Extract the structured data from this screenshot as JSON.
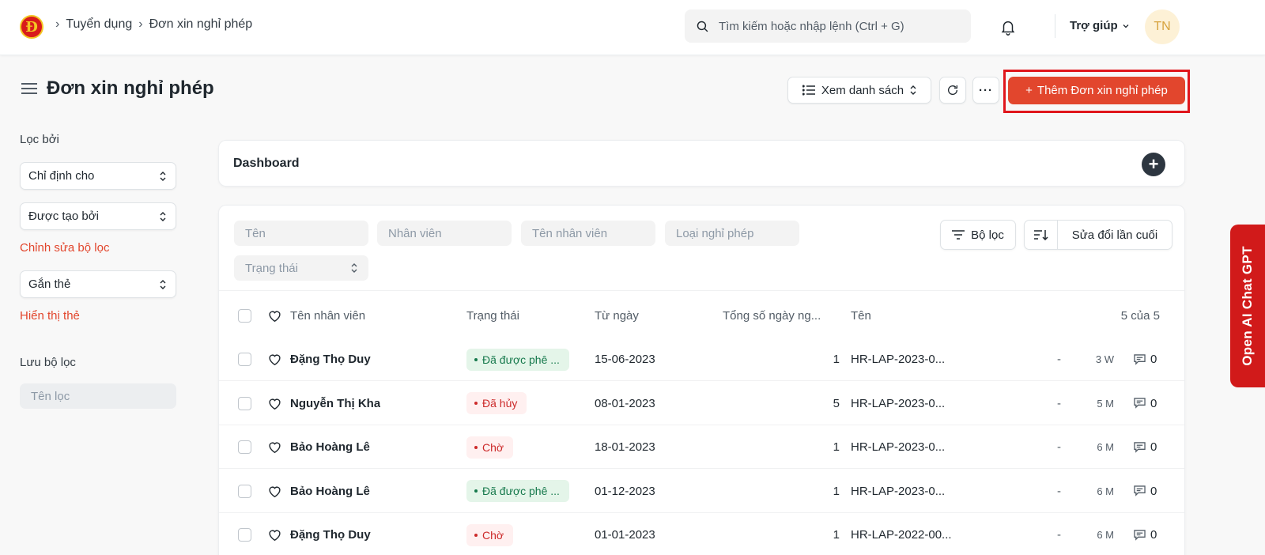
{
  "navbar": {
    "logo_letter": "Đ",
    "breadcrumbs": [
      "Tuyển dụng",
      "Đơn xin nghỉ phép"
    ],
    "search_placeholder": "Tìm kiếm hoặc nhập lệnh (Ctrl + G)",
    "help_label": "Trợ giúp",
    "avatar_initials": "TN"
  },
  "page": {
    "title": "Đơn xin nghỉ phép",
    "view_label": "Xem danh sách",
    "more_label": "···",
    "primary_label": "Thêm Đơn xin nghỉ phép",
    "primary_plus": "+"
  },
  "sidebar": {
    "filter_by_label": "Lọc bởi",
    "assigned_to": "Chỉ định cho",
    "created_by": "Được tạo bởi",
    "edit_filters_link": "Chỉnh sửa bộ lọc",
    "tags_select": "Gắn thẻ",
    "show_tags_link": "Hiển thị thẻ",
    "save_filter_label": "Lưu bộ lọc",
    "filter_name_placeholder": "Tên lọc"
  },
  "dashboard": {
    "title": "Dashboard",
    "add_symbol": "+"
  },
  "list": {
    "filters": {
      "name": "Tên",
      "employee": "Nhân viên",
      "employee_name": "Tên nhân viên",
      "leave_type": "Loại nghỉ phép",
      "status": "Trạng thái"
    },
    "filter_button": "Bộ lọc",
    "sort_label": "Sửa đổi lần cuối",
    "columns": {
      "employee_name": "Tên nhân viên",
      "status": "Trạng thái",
      "from_date": "Từ ngày",
      "total_days": "Tổng số ngày ng...",
      "name": "Tên",
      "count": "5 của 5"
    },
    "rows": [
      {
        "employee_name": "Đặng Thọ Duy",
        "status": "Đã được phê ...",
        "status_color": "green",
        "from_date": "15-06-2023",
        "total_days": "1",
        "name": "HR-LAP-2023-0...",
        "dash": "-",
        "modified": "3 W",
        "comments": "0"
      },
      {
        "employee_name": "Nguyễn Thị Kha",
        "status": "Đã hủy",
        "status_color": "red",
        "from_date": "08-01-2023",
        "total_days": "5",
        "name": "HR-LAP-2023-0...",
        "dash": "-",
        "modified": "5 M",
        "comments": "0"
      },
      {
        "employee_name": "Bảo Hoàng Lê",
        "status": "Chờ",
        "status_color": "red",
        "from_date": "18-01-2023",
        "total_days": "1",
        "name": "HR-LAP-2023-0...",
        "dash": "-",
        "modified": "6 M",
        "comments": "0"
      },
      {
        "employee_name": "Bảo Hoàng Lê",
        "status": "Đã được phê ...",
        "status_color": "green",
        "from_date": "01-12-2023",
        "total_days": "1",
        "name": "HR-LAP-2023-0...",
        "dash": "-",
        "modified": "6 M",
        "comments": "0"
      },
      {
        "employee_name": "Đặng Thọ Duy",
        "status": "Chờ",
        "status_color": "red",
        "from_date": "01-01-2023",
        "total_days": "1",
        "name": "HR-LAP-2022-00...",
        "dash": "-",
        "modified": "6 M",
        "comments": "0"
      }
    ]
  },
  "chat_tab": {
    "label": "Open AI Chat GPT"
  },
  "colors": {
    "primary": "#e2462d",
    "highlight": "#e0161c",
    "chat_tab": "#d11a1a",
    "approved_bg": "#e4f5e9",
    "approved_text": "#16794c",
    "pending_bg": "#fff0f0",
    "pending_text": "#cc2929"
  }
}
